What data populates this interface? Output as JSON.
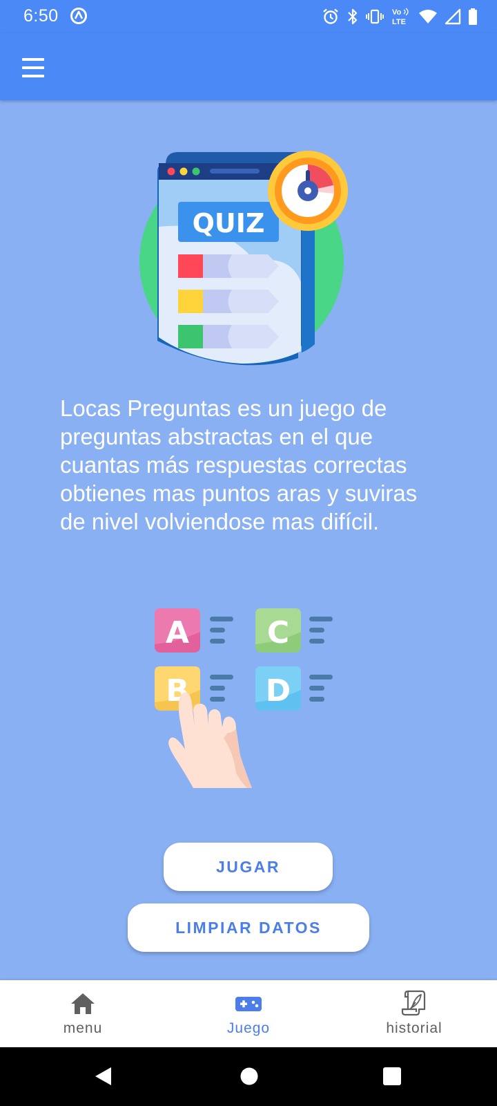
{
  "status_bar": {
    "time": "6:50",
    "left_icon": "app-notification-icon",
    "right_icons": [
      "alarm-icon",
      "bluetooth-icon",
      "vibrate-icon",
      "volte-icon",
      "wifi-icon",
      "signal-icon",
      "battery-icon"
    ],
    "volte_text_top": "Vo",
    "volte_text_bottom": "LTE"
  },
  "app_bar": {
    "menu_icon": "hamburger-menu-icon"
  },
  "illustration_quiz": {
    "label": "QUIZ"
  },
  "description": "Locas Preguntas es un juego de preguntas abstractas en el que cuantas más respuestas correctas obtienes mas puntos aras y suviras de nivel volviendose mas difícil.",
  "illustration_options": {
    "letters": [
      "A",
      "C",
      "B",
      "D"
    ]
  },
  "buttons": {
    "play_label": "JUGAR",
    "clear_label": "LIMPIAR DATOS"
  },
  "bottom_nav": {
    "items": [
      {
        "label": "menu",
        "icon": "home-icon",
        "active": false
      },
      {
        "label": "Juego",
        "icon": "gamepad-icon",
        "active": true
      },
      {
        "label": "historial",
        "icon": "scroll-quill-icon",
        "active": false
      }
    ]
  },
  "colors": {
    "primary": "#4b89f7",
    "background": "#8ab0f4",
    "accent_text": "#4b7ee8",
    "inactive_text": "#5f5f5f"
  }
}
